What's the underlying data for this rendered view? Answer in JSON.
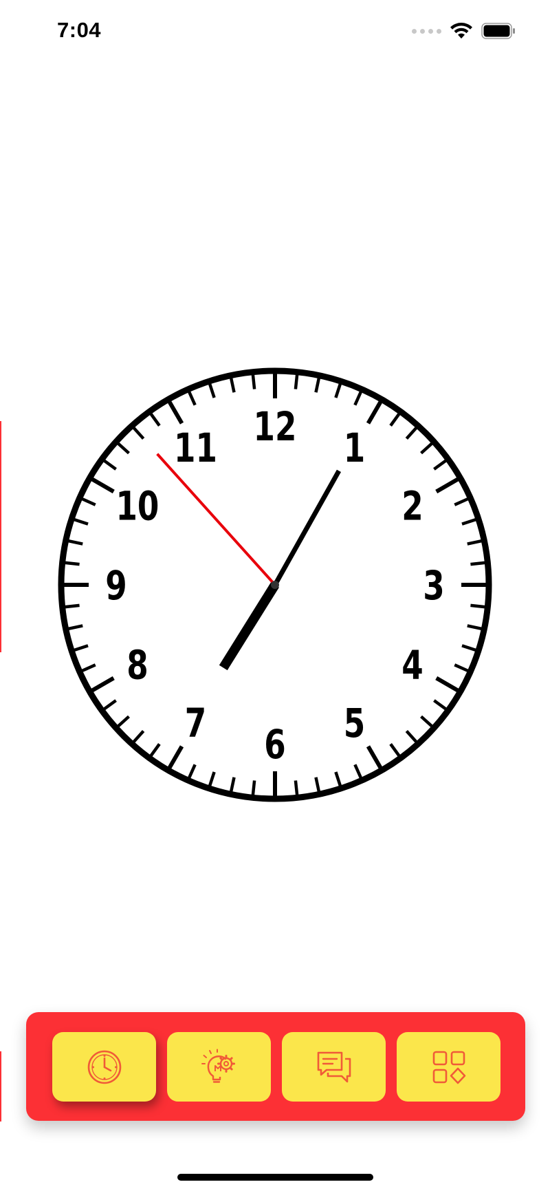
{
  "status_bar": {
    "time": "7:04"
  },
  "clock": {
    "numerals": [
      "12",
      "1",
      "2",
      "3",
      "4",
      "5",
      "6",
      "7",
      "8",
      "9",
      "10",
      "11"
    ],
    "time_shown": {
      "hours": 7,
      "minutes": 4,
      "seconds": 53
    },
    "face_color": "#ffffff",
    "hand_color": "#000000",
    "second_hand_color": "#e8000b"
  },
  "tab_bar": {
    "background_color": "#fc3035",
    "button_color": "#fbe64b",
    "icon_color": "#f05a38",
    "tabs": [
      {
        "icon": "clock-icon",
        "active": true
      },
      {
        "icon": "lightbulb-gear-icon",
        "active": false
      },
      {
        "icon": "chat-bubbles-icon",
        "active": false
      },
      {
        "icon": "apps-grid-icon",
        "active": false
      }
    ]
  }
}
